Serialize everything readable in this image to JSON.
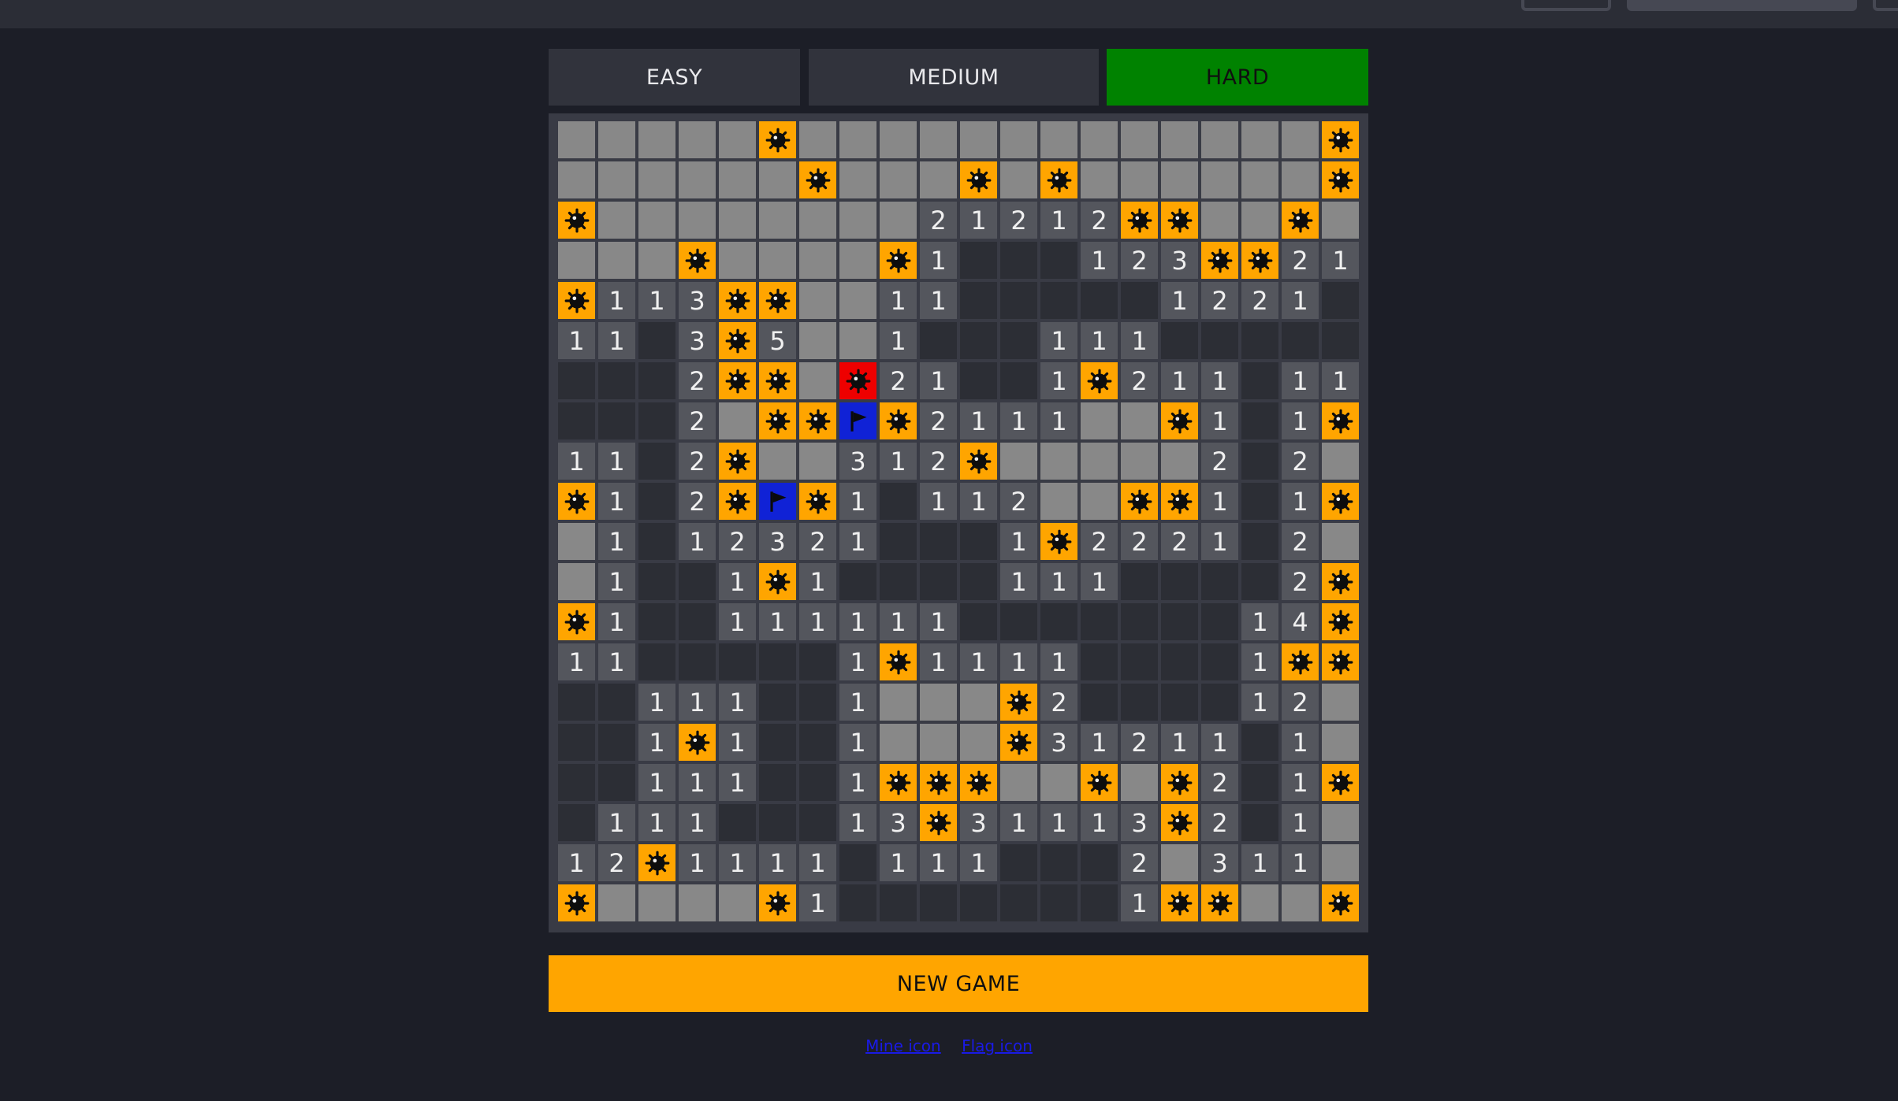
{
  "difficulty": {
    "easy_label": "EASY",
    "medium_label": "MEDIUM",
    "hard_label": "HARD",
    "selected": "HARD"
  },
  "board": {
    "rows": 20,
    "cols": 20,
    "legend": {
      "H": "hidden",
      "E": "revealed-empty",
      "1-8": "revealed-number",
      "M": "mine",
      "X": "exploded-mine",
      "F": "flag"
    },
    "grid": [
      [
        "H",
        "H",
        "H",
        "H",
        "H",
        "M",
        "H",
        "H",
        "H",
        "H",
        "H",
        "H",
        "H",
        "H",
        "H",
        "H",
        "H",
        "H",
        "H",
        "M"
      ],
      [
        "H",
        "H",
        "H",
        "H",
        "H",
        "H",
        "M",
        "H",
        "H",
        "H",
        "M",
        "H",
        "M",
        "H",
        "H",
        "H",
        "H",
        "H",
        "H",
        "M"
      ],
      [
        "M",
        "H",
        "H",
        "H",
        "H",
        "H",
        "H",
        "H",
        "H",
        "2",
        "1",
        "2",
        "1",
        "2",
        "M",
        "M",
        "H",
        "H",
        "M",
        "H"
      ],
      [
        "H",
        "H",
        "H",
        "M",
        "H",
        "H",
        "H",
        "H",
        "M",
        "1",
        "E",
        "E",
        "E",
        "1",
        "2",
        "3",
        "M",
        "M",
        "2",
        "1"
      ],
      [
        "M",
        "1",
        "1",
        "3",
        "M",
        "M",
        "H",
        "H",
        "1",
        "1",
        "E",
        "E",
        "E",
        "E",
        "E",
        "1",
        "2",
        "2",
        "1",
        "E"
      ],
      [
        "1",
        "1",
        "E",
        "3",
        "M",
        "5",
        "H",
        "H",
        "1",
        "E",
        "E",
        "E",
        "1",
        "1",
        "1",
        "E",
        "E",
        "E",
        "E",
        "E"
      ],
      [
        "E",
        "E",
        "E",
        "2",
        "M",
        "M",
        "H",
        "X",
        "2",
        "1",
        "E",
        "E",
        "1",
        "M",
        "2",
        "1",
        "1",
        "E",
        "1",
        "1"
      ],
      [
        "E",
        "E",
        "E",
        "2",
        "H",
        "M",
        "M",
        "F",
        "M",
        "2",
        "1",
        "1",
        "1",
        "H",
        "H",
        "M",
        "1",
        "E",
        "1",
        "M"
      ],
      [
        "1",
        "1",
        "E",
        "2",
        "M",
        "H",
        "H",
        "3",
        "1",
        "2",
        "M",
        "H",
        "H",
        "H",
        "H",
        "H",
        "2",
        "E",
        "2",
        "H"
      ],
      [
        "M",
        "1",
        "E",
        "2",
        "M",
        "F",
        "M",
        "1",
        "E",
        "1",
        "1",
        "2",
        "H",
        "H",
        "M",
        "M",
        "1",
        "E",
        "1",
        "M"
      ],
      [
        "H",
        "1",
        "E",
        "1",
        "2",
        "3",
        "2",
        "1",
        "E",
        "E",
        "E",
        "1",
        "M",
        "2",
        "2",
        "2",
        "1",
        "E",
        "2",
        "H"
      ],
      [
        "H",
        "1",
        "E",
        "E",
        "1",
        "M",
        "1",
        "E",
        "E",
        "E",
        "E",
        "1",
        "1",
        "1",
        "E",
        "E",
        "E",
        "E",
        "2",
        "M"
      ],
      [
        "M",
        "1",
        "E",
        "E",
        "1",
        "1",
        "1",
        "1",
        "1",
        "1",
        "E",
        "E",
        "E",
        "E",
        "E",
        "E",
        "E",
        "1",
        "4",
        "M"
      ],
      [
        "1",
        "1",
        "E",
        "E",
        "E",
        "E",
        "E",
        "1",
        "M",
        "1",
        "1",
        "1",
        "1",
        "E",
        "E",
        "E",
        "E",
        "1",
        "M",
        "M"
      ],
      [
        "E",
        "E",
        "1",
        "1",
        "1",
        "E",
        "E",
        "1",
        "H",
        "H",
        "H",
        "M",
        "2",
        "E",
        "E",
        "E",
        "E",
        "1",
        "2",
        "H"
      ],
      [
        "E",
        "E",
        "1",
        "M",
        "1",
        "E",
        "E",
        "1",
        "H",
        "H",
        "H",
        "M",
        "3",
        "1",
        "2",
        "1",
        "1",
        "E",
        "1",
        "H"
      ],
      [
        "E",
        "E",
        "1",
        "1",
        "1",
        "E",
        "E",
        "1",
        "M",
        "M",
        "M",
        "H",
        "H",
        "M",
        "H",
        "M",
        "2",
        "E",
        "1",
        "M"
      ],
      [
        "E",
        "1",
        "1",
        "1",
        "E",
        "E",
        "E",
        "1",
        "3",
        "M",
        "3",
        "1",
        "1",
        "1",
        "3",
        "M",
        "2",
        "E",
        "1",
        "H"
      ],
      [
        "1",
        "2",
        "M",
        "1",
        "1",
        "1",
        "1",
        "E",
        "1",
        "1",
        "1",
        "E",
        "E",
        "E",
        "2",
        "H",
        "3",
        "1",
        "1",
        "H"
      ],
      [
        "M",
        "H",
        "H",
        "H",
        "H",
        "M",
        "1",
        "E",
        "E",
        "E",
        "E",
        "E",
        "E",
        "E",
        "1",
        "M",
        "M",
        "H",
        "H",
        "M"
      ]
    ]
  },
  "new_game_label": "NEW GAME",
  "credits": {
    "mine_icon_link": "Mine icon",
    "flag_icon_link": "Flag icon"
  },
  "colors": {
    "background": "#1c1e27",
    "hidden_cell": "#888888",
    "number_cell": "#54565d",
    "empty_cell": "#2c2e35",
    "mine_cell": "#ffa500",
    "exploded_cell": "#ee0000",
    "flag_cell": "#1022d6",
    "hard_selected": "#008200",
    "new_game": "#ffa500"
  },
  "icons": {
    "mine": "mine-icon",
    "flag": "flag-icon"
  }
}
